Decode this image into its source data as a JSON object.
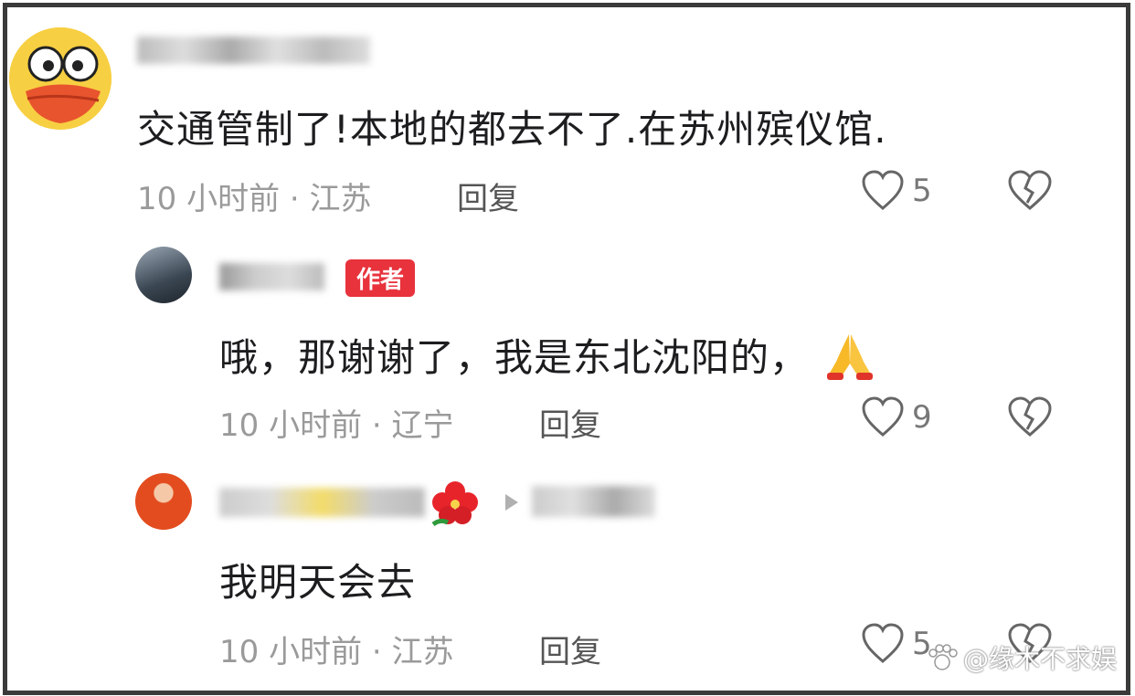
{
  "comments": [
    {
      "text": "交通管制了!本地的都去不了.在苏州殡仪馆.",
      "meta": "10 小时前 · 江苏",
      "reply": "回复",
      "likes": "5"
    },
    {
      "badge": "作者",
      "text": "哦，那谢谢了，我是东北沈阳的，",
      "meta": "10 小时前 · 辽宁",
      "reply": "回复",
      "likes": "9"
    },
    {
      "text": "我明天会去",
      "meta": "10 小时前 · 江苏",
      "reply": "回复",
      "likes": "5"
    }
  ],
  "watermark": "@缘木不求娱",
  "colors": {
    "badge": "#e8323c",
    "meta": "#9a9a9a",
    "text": "#1d1d1f"
  },
  "icons": [
    "heart-icon",
    "broken-heart-icon",
    "pray-emoji",
    "hibiscus-emoji",
    "play-arrow-icon"
  ]
}
